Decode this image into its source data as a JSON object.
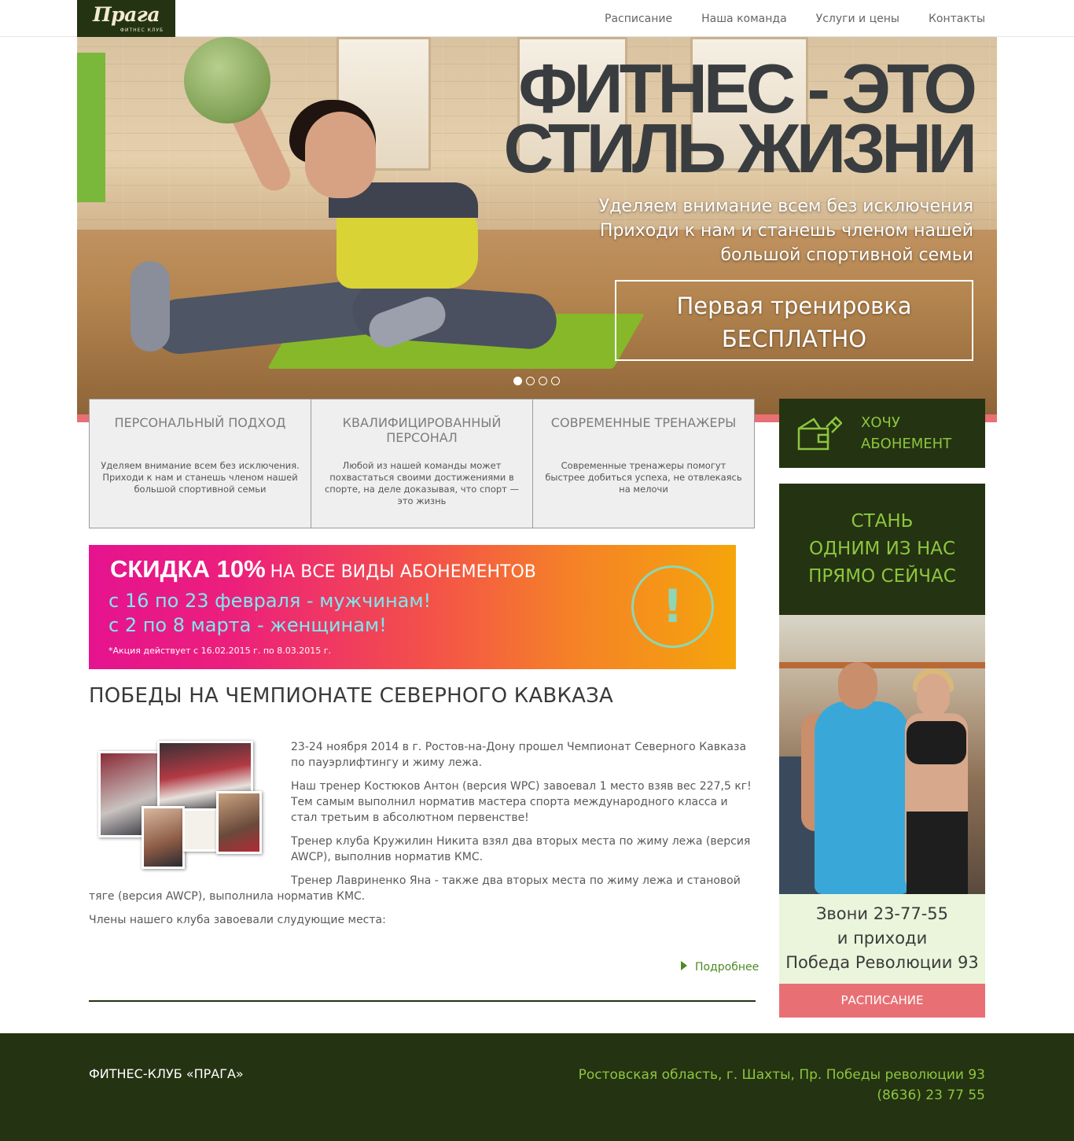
{
  "header": {
    "logo_text": "Прага",
    "logo_subtext": "ФИТНЕС КЛУБ",
    "nav": [
      {
        "label": "Расписание"
      },
      {
        "label": "Наша команда"
      },
      {
        "label": "Услуги и цены"
      },
      {
        "label": "Контакты"
      }
    ]
  },
  "hero": {
    "title_line1": "ФИТНЕС - ЭТО",
    "title_line2": "СТИЛЬ ЖИЗНИ",
    "subtitle_line1": "Уделяем внимание всем без исключения",
    "subtitle_line2": "Приходи к нам и станешь членом нашей",
    "subtitle_line3": "большой спортивной семьи",
    "cta_line1": "Первая тренировка",
    "cta_line2": "БЕСПЛАТНО",
    "slides_total": 4,
    "slide_active": 1
  },
  "features": [
    {
      "title": "ПЕРСОНАЛЬНЫЙ ПОДХОД",
      "text": "Уделяем внимание всем без исключения. Приходи к нам и станешь членом нашей большой спортивной семьи"
    },
    {
      "title": "КВАЛИФИЦИРОВАННЫЙ ПЕРСОНАЛ",
      "text": "Любой из нашей команды может похвастаться своими достижениями в спорте, на деле доказывая, что спорт — это жизнь"
    },
    {
      "title": "СОВРЕМЕННЫЕ ТРЕНАЖЕРЫ",
      "text": "Современные тренажеры помогут быстрее добиться успеха, не отвлекаясь на мелочи"
    }
  ],
  "sidebar": {
    "subscription_line1": "ХОЧУ",
    "subscription_line2": "АБОНЕМЕНТ",
    "join_line1": "СТАНЬ",
    "join_line2": "ОДНИМ ИЗ НАС",
    "join_line3": "ПРЯМО СЕЙЧАС",
    "contact_line1": "Звони 23-77-55",
    "contact_line2": "и приходи",
    "contact_line3": "Победа Революции 93",
    "schedule_button": "РАСПИСАНИЕ"
  },
  "promo": {
    "discount": "СКИДКА 10%",
    "discount_rest": "НА ВСЕ ВИДЫ АБОНЕМЕНТОВ",
    "men": "с 16 по 23 февраля - мужчинам!",
    "women": "с 2 по 8 марта - женщинам!",
    "note": "*Акция действует с 16.02.2015 г.  по 8.03.2015 г.",
    "alert_symbol": "!"
  },
  "article": {
    "title": "ПОБЕДЫ НА ЧЕМПИОНАТЕ СЕВЕРНОГО КАВКАЗА",
    "paragraphs": [
      "23-24 ноября 2014 в г. Ростов-на-Дону прошел Чемпионат Северного Кавказа по пауэрлифтингу и жиму лежа.",
      "Наш тренер Костюков Антон (версия WPC) завоевал 1 место взяв вес 227,5 кг! Тем самым выполнил норматив мастера спорта международного класса и стал третьим в абсолютном первенстве!",
      "Тренер клуба Кружилин Никита взял два вторых места по жиму лежа (версия AWCP), выполнив норматив КМС.",
      "Тренер Лавриненко Яна - также два вторых места по жиму лежа и становой тяге (версия AWCP), выполнила норматив КМС.",
      "Члены нашего клуба завоевали слудующие места:"
    ],
    "more_link": "Подробнее"
  },
  "footer": {
    "club_name": "ФИТНЕС-КЛУБ «ПРАГА»",
    "address": "Ростовская область, г. Шахты, Пр. Победы революции 93",
    "phone": "(8636) 23 77 55"
  },
  "colors": {
    "dark_green": "#243311",
    "light_green": "#8dc63f",
    "pink_accent": "#e86f74",
    "contact_bg": "#eaf5dc"
  }
}
